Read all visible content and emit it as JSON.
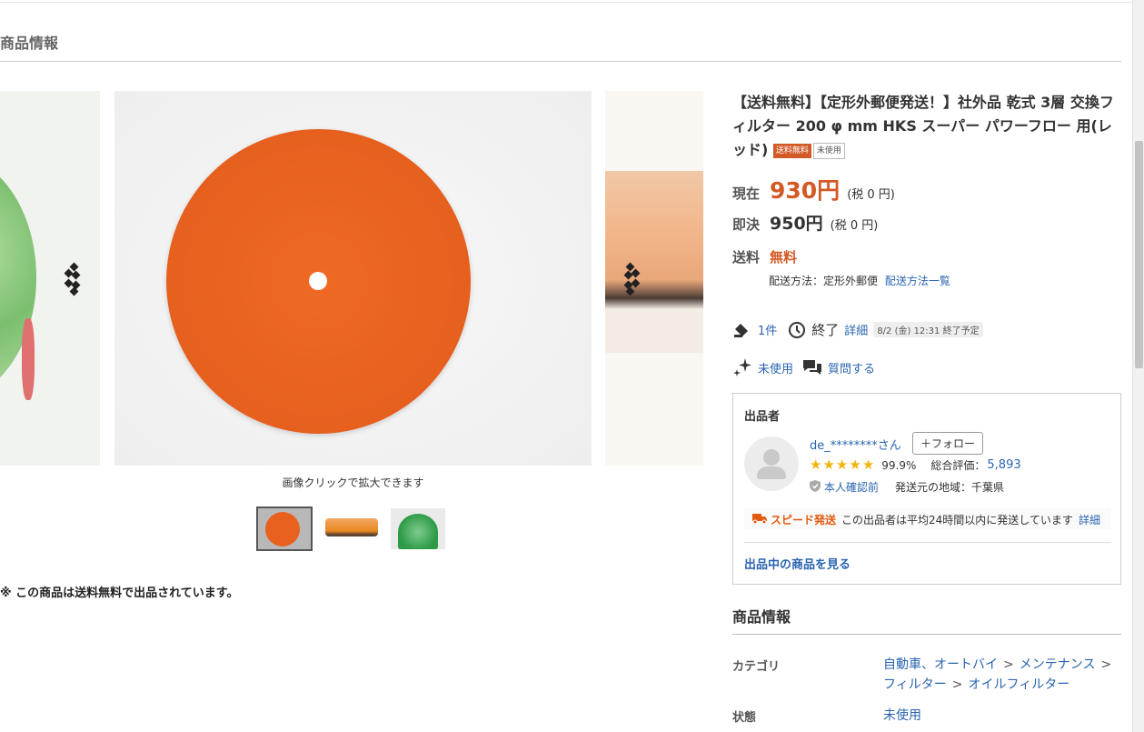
{
  "section_title": "商品情報",
  "gallery": {
    "caption": "画像クリックで拡大できます",
    "thumb_count": 3,
    "active_thumb": 1
  },
  "note": "※ この商品は送料無料で出品されています。",
  "product": {
    "title": "【送料無料】【定形外郵便発送！】社外品 乾式 3層 交換フィルター 200 φ mm HKS スーパー パワーフロー 用(レッド)",
    "badge_free": "送料無料",
    "badge_unused": "未使用"
  },
  "price": {
    "current_label": "現在",
    "current_value": "930円",
    "current_tax": "(税 0 円)",
    "buyout_label": "即決",
    "buyout_value": "950円",
    "buyout_tax": "(税 0 円)"
  },
  "shipping": {
    "label": "送料",
    "value": "無料",
    "method_prefix": "配送方法：定形外郵便",
    "method_link": "配送方法一覧"
  },
  "stats": {
    "bids": "1件",
    "end_label": "終了",
    "end_detail_link": "詳細",
    "end_date": "8/2 (金) 12:31 終了予定",
    "condition": "未使用",
    "question": "質問する"
  },
  "seller": {
    "heading": "出品者",
    "name": "de_********さん",
    "follow": "＋フォロー",
    "rating_percent": "99.9%",
    "total_label": "総合評価：",
    "total_value": "5,893",
    "verify": "本人確認前",
    "region": "発送元の地域：千葉県",
    "speed_tag": "スピード発送",
    "speed_text": "この出品者は平均24時間以内に発送しています",
    "speed_link": "詳細",
    "items_link": "出品中の商品を見る",
    "stars": 5
  },
  "info": {
    "heading": "商品情報",
    "category_label": "カテゴリ",
    "category": [
      "自動車、オートバイ",
      "メンテナンス",
      "フィルター",
      "オイルフィルター"
    ],
    "condition_label": "状態",
    "condition_value": "未使用"
  },
  "colors": {
    "accent_price": "#d35a26",
    "link": "#2a64b0",
    "star": "#f2b40c"
  }
}
